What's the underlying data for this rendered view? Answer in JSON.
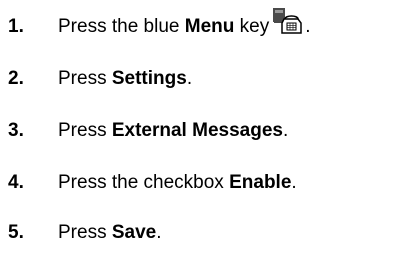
{
  "steps": [
    {
      "number": "1.",
      "pre": "Press the blue ",
      "bold": "Menu",
      "post": " key",
      "icon": "menu-key-phone-icon",
      "end": "."
    },
    {
      "number": "2.",
      "pre": "Press ",
      "bold": "Settings",
      "post": "."
    },
    {
      "number": "3.",
      "pre": "Press ",
      "bold": "External Messages",
      "post": "."
    },
    {
      "number": "4.",
      "pre": "Press the checkbox ",
      "bold": "Enable",
      "post": "."
    },
    {
      "number": "5.",
      "pre": "Press ",
      "bold": "Save",
      "post": "."
    }
  ]
}
